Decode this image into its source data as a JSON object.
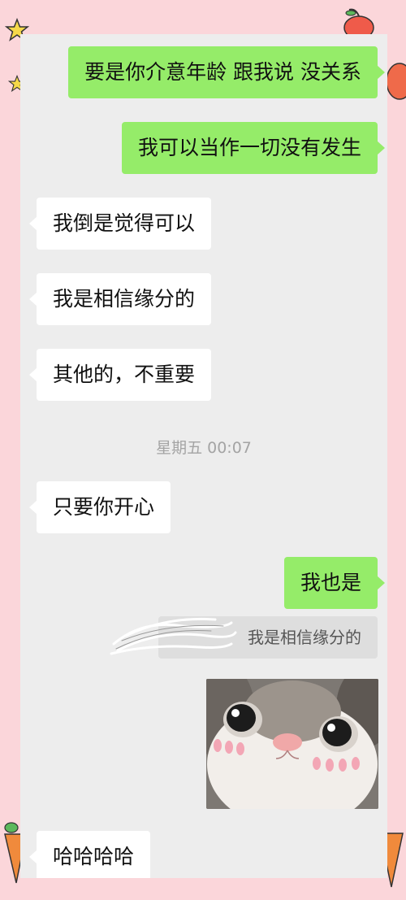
{
  "messages": [
    {
      "side": "out",
      "text": "要是你介意年龄 跟我说 没关系"
    },
    {
      "side": "out",
      "text": "我可以当作一切没有发生"
    },
    {
      "side": "in",
      "text": "我倒是觉得可以"
    },
    {
      "side": "in",
      "text": "我是相信缘分的"
    },
    {
      "side": "in",
      "text": "其他的，不重要"
    },
    {
      "side": "in",
      "text": "只要你开心"
    },
    {
      "side": "out",
      "text": "我也是"
    },
    {
      "side": "in",
      "text": "哈哈哈哈"
    }
  ],
  "timestamp": "星期五 00:07",
  "reply_quote": {
    "text": "我是相信缘分的"
  },
  "sticker": {
    "name": "cat-sticker-image"
  },
  "colors": {
    "outgoing_bubble": "#95ec69",
    "incoming_bubble": "#ffffff",
    "chat_background": "#ededed",
    "page_background": "#fbd6da"
  }
}
